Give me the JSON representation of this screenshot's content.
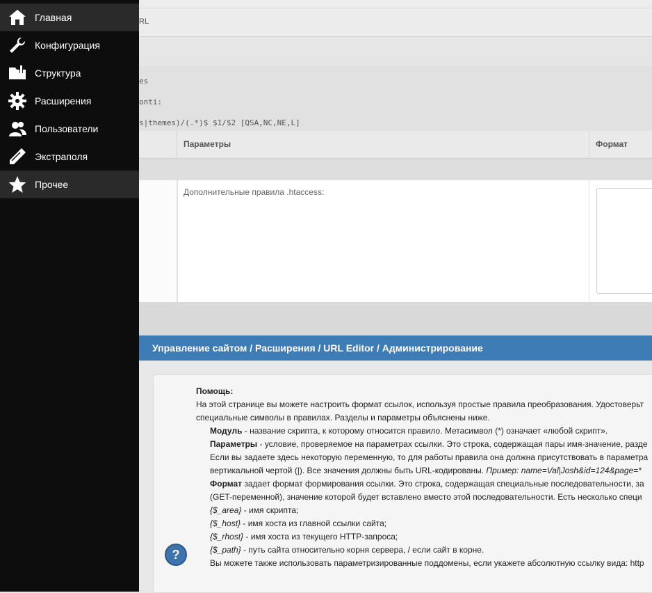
{
  "sidebar": {
    "items": [
      {
        "label": "Главная",
        "icon": "home-icon"
      },
      {
        "label": "Конфигурация",
        "icon": "wrench-icon"
      },
      {
        "label": "Структура",
        "icon": "folder-icon"
      },
      {
        "label": "Расширения",
        "icon": "gear-icon"
      },
      {
        "label": "Пользователи",
        "icon": "users-icon"
      },
      {
        "label": "Экстраполя",
        "icon": "pencil-icon"
      },
      {
        "label": "Прочее",
        "icon": "star-icon"
      }
    ]
  },
  "top": {
    "url_fragment": "RL",
    "code_line1": "es",
    "code_line2": "onti:",
    "code_line3": "s|themes)/(.*)$ $1/$2 [QSA,NC,NE,L]"
  },
  "table": {
    "headers": {
      "params": "Параметры",
      "format": "Формат"
    },
    "row_params_text": "Дополнительные правила .htaccess:"
  },
  "breadcrumb": "Управление сайтом / Расширения / URL Editor / Администрирование",
  "help": {
    "title": "Помощь:",
    "intro1": "На этой странице вы можете настроить формат ссылок, используя простые правила преобразования. Удостоверьт",
    "intro2": "специальные символы в правилах. Разделы и параметры объяснены ниже.",
    "module_term": "Модуль",
    "module_text": " - название скрипта, к которому относится правило. Метасимвол (*) означает «любой скрипт».",
    "params_term": "Параметры",
    "params_text": " - условие, проверяемое на параметрах ссылки. Это строка, содержащая пары имя-значение, разде",
    "params_line2": "Если вы задаете здесь некоторую переменную, то для работы правила она должна присутствовать в параметра",
    "params_line3a": "вертикальной чертой (|). Все значения должны быть URL-кодированы. ",
    "params_line3b": "Пример: name=Val|Josh&id=124&page=*",
    "format_term": "Формат",
    "format_text": " задает формат формирования ссылки. Это строка, содержащая специальные последовательности, за",
    "format_line2": "(GET-переменной), значение которой будет вставлено вместо этой последовательности. Есть несколько специ",
    "vars": [
      {
        "name": "{$_area}",
        "text": " - имя скрипта;"
      },
      {
        "name": "{$_host}",
        "text": " - имя хоста из главной ссылки сайта;"
      },
      {
        "name": "{$_rhost}",
        "text": " - имя хоста из текущего HTTP-запроса;"
      },
      {
        "name": "{$_path}",
        "text": " - путь сайта относительно корня сервера, / если сайт в корне."
      }
    ],
    "last_line": "Вы можете также использовать параметризированные поддомены, если укажете абсолютную ссылку вида: http"
  },
  "colors": {
    "breadcrumb": "#3d7cb5",
    "sidebar": "#0d0d0d"
  }
}
